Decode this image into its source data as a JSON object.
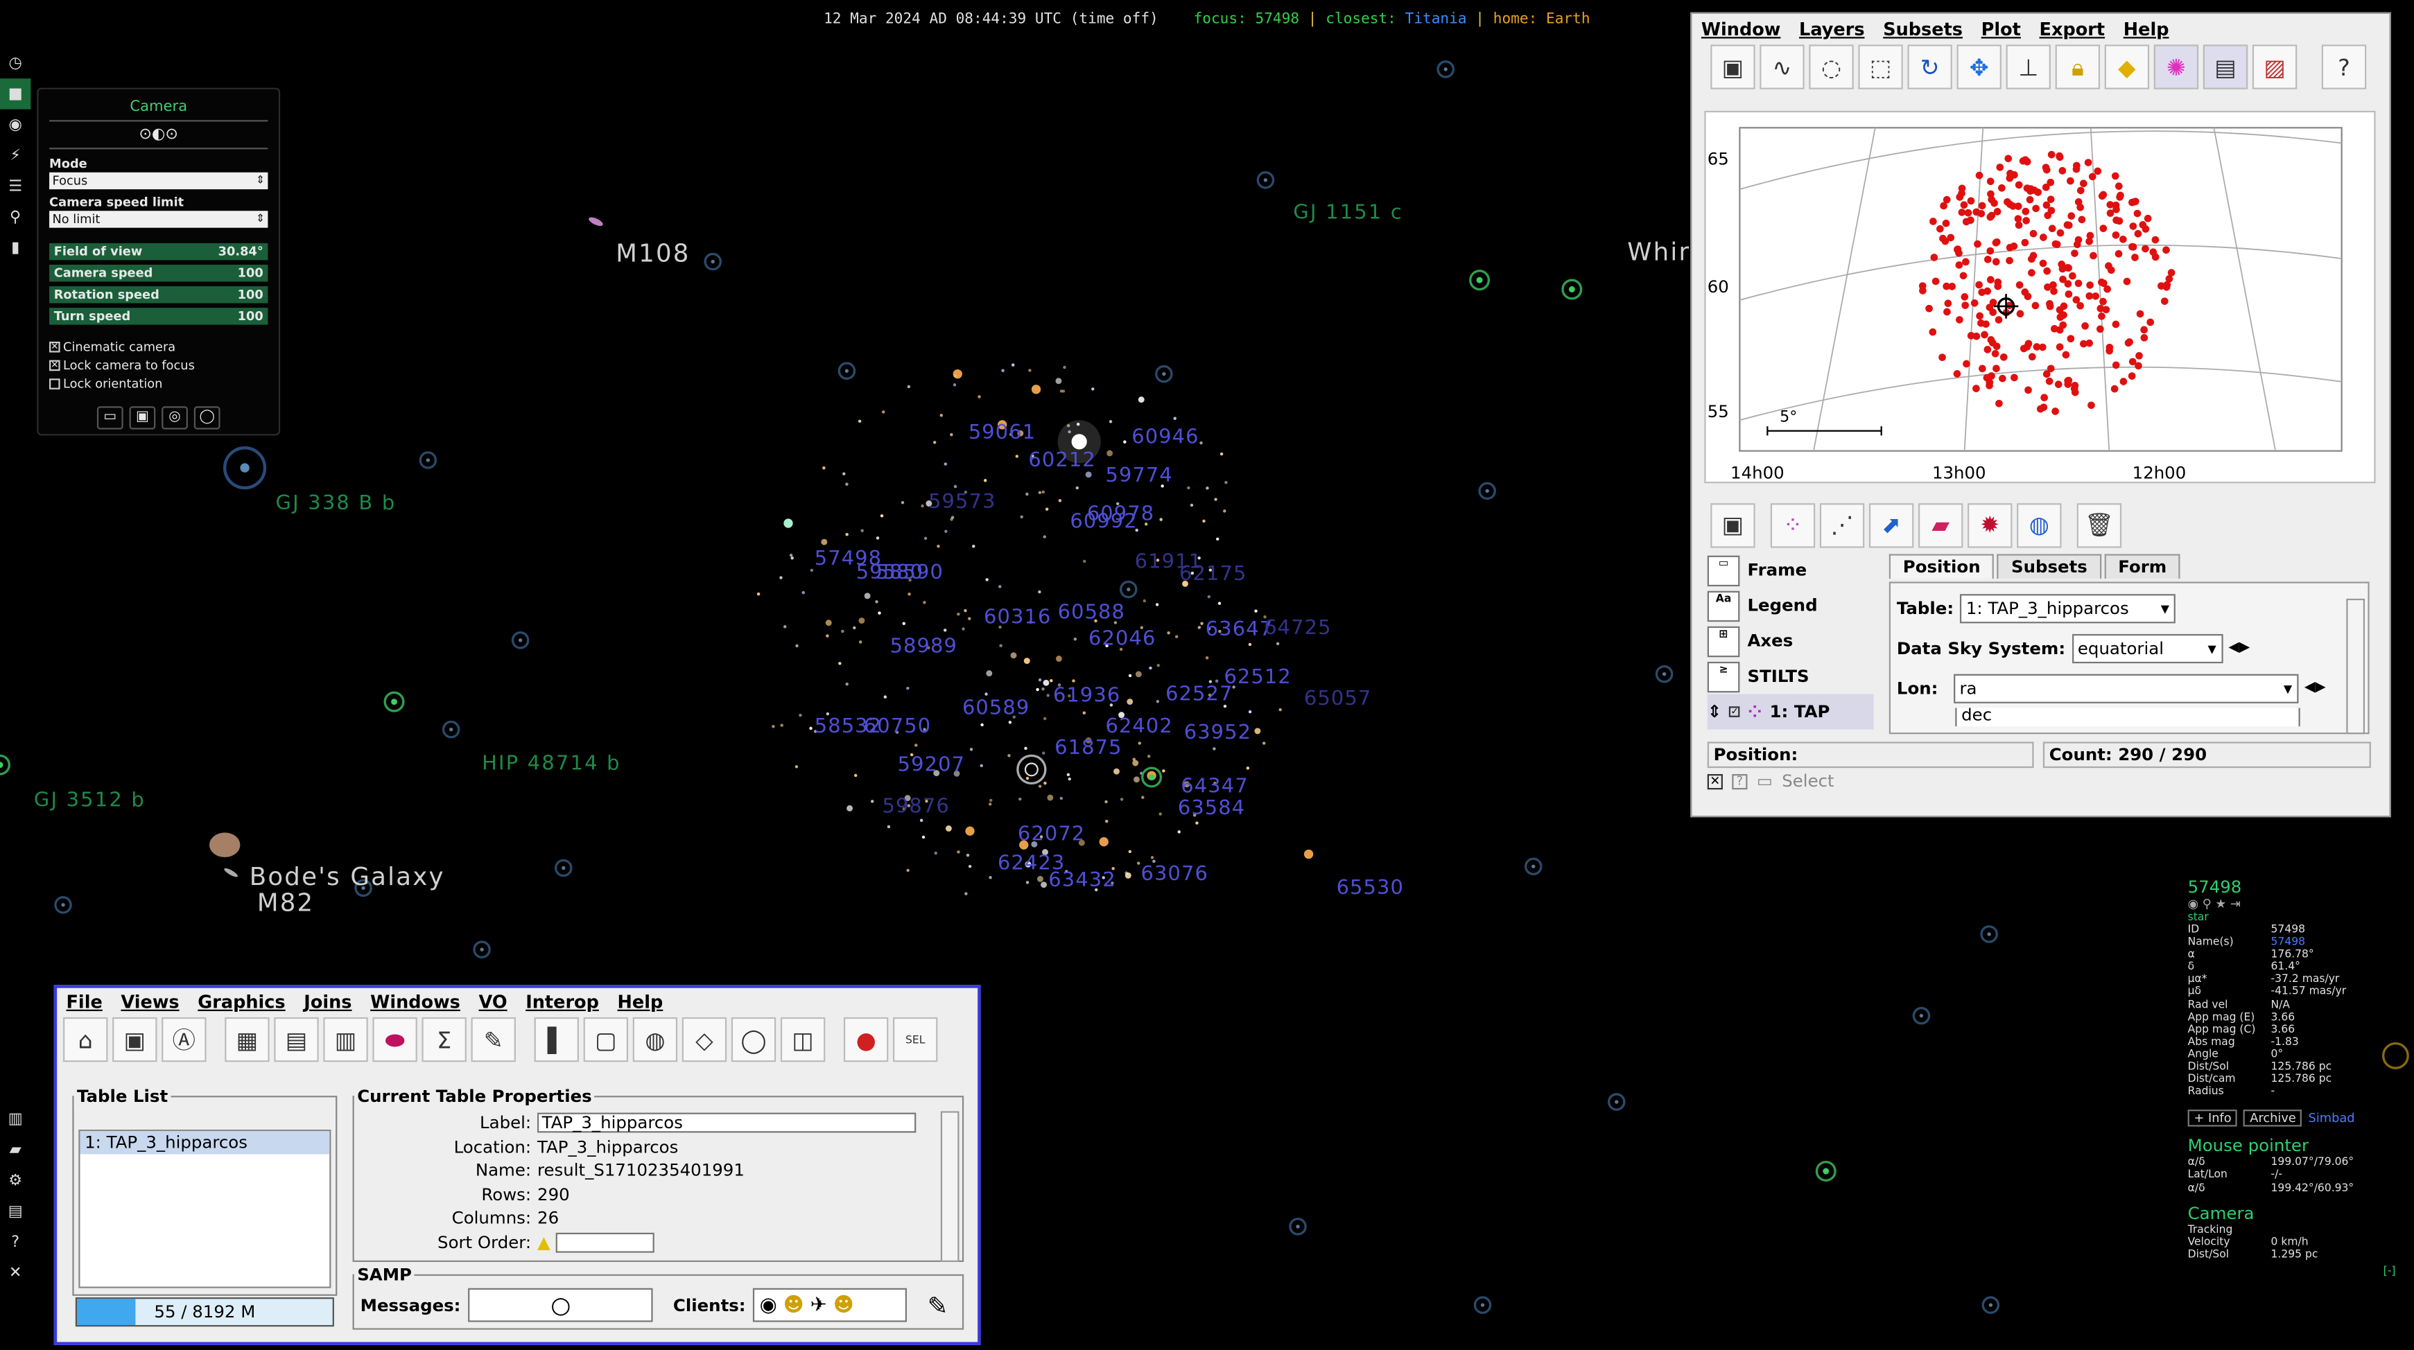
{
  "status_bar": {
    "datetime": "12 Mar 2024 AD 08:44:39 UTC (time off)",
    "focus_label": "focus:",
    "focus_value": "57498",
    "closest_label": "closest:",
    "closest_value": "Titania",
    "home_label": "home:",
    "home_value": "Earth",
    "separator": "|",
    "colors": {
      "focus": "#32d04a",
      "closest": "#3a8cff",
      "home": "#e8a020"
    }
  },
  "sky": {
    "deep_sky_labels": [
      "M108",
      "Bode's Galaxy",
      "M82",
      "Whir"
    ],
    "exoplanet_labels": [
      "GJ 1151 c",
      "GJ 338 B b",
      "HIP 48714 b",
      "GJ 3512 b"
    ],
    "star_ids": [
      "59061",
      "60212",
      "60946",
      "59774",
      "60978",
      "60992",
      "57498",
      "58590",
      "59580",
      "60316",
      "60588",
      "58989",
      "62046",
      "63647",
      "62512",
      "60589",
      "61936",
      "62527",
      "58532",
      "60750",
      "62402",
      "63952",
      "59207",
      "61875",
      "64347",
      "63584",
      "62072",
      "62423",
      "63432",
      "63076",
      "65530"
    ],
    "star_ids_dim": [
      "59573",
      "61911",
      "62175",
      "64725",
      "65057",
      "59876"
    ]
  },
  "camera_panel": {
    "title": "Camera",
    "mode_label": "Mode",
    "mode_value": "Focus",
    "speed_limit_label": "Camera speed limit",
    "speed_limit_value": "No limit",
    "fov_label": "Field of view",
    "fov_value": "30.84°",
    "camera_speed_label": "Camera speed",
    "camera_speed_value": "100",
    "rotation_speed_label": "Rotation speed",
    "rotation_speed_value": "100",
    "turn_speed_label": "Turn speed",
    "turn_speed_value": "100",
    "cinematic_label": "Cinematic camera",
    "cinematic_checked": true,
    "lock_focus_label": "Lock camera to focus",
    "lock_focus_checked": true,
    "lock_orientation_label": "Lock orientation",
    "lock_orientation_checked": false
  },
  "object_info": {
    "name": "57498",
    "type": "star",
    "rows": [
      {
        "k": "ID",
        "v": "57498"
      },
      {
        "k": "Name(s)",
        "v": "57498"
      },
      {
        "k": "α",
        "v": "176.78°"
      },
      {
        "k": "δ",
        "v": "61.4°"
      },
      {
        "k": "μα*",
        "v": "-37.2 mas/yr"
      },
      {
        "k": "μδ",
        "v": "-41.57 mas/yr"
      },
      {
        "k": "Rad vel",
        "v": "N/A"
      },
      {
        "k": "App mag (E)",
        "v": "3.66"
      },
      {
        "k": "App mag (C)",
        "v": "3.66"
      },
      {
        "k": "Abs mag",
        "v": "-1.83"
      },
      {
        "k": "Angle",
        "v": "0°"
      },
      {
        "k": "Dist/Sol",
        "v": "125.786 pc"
      },
      {
        "k": "Dist/cam",
        "v": "125.786 pc"
      },
      {
        "k": "Radius",
        "v": "-"
      }
    ],
    "more_info_label": "+ Info",
    "archive_label": "Archive",
    "simbad_label": "Simbad",
    "mouse_title": "Mouse pointer",
    "mouse_rows": [
      {
        "k": "α/δ",
        "v": "199.07°/79.06°"
      },
      {
        "k": "Lat/Lon",
        "v": "-/-"
      },
      {
        "k": "α/δ",
        "v": "199.42°/60.93°"
      }
    ],
    "camera_title": "Camera",
    "camera_rows": [
      {
        "k": "Tracking",
        "v": ""
      },
      {
        "k": "Velocity",
        "v": "0 km/h"
      },
      {
        "k": "Dist/Sol",
        "v": "1.295 pc"
      }
    ],
    "corner_mark": "[-]"
  },
  "topcat": {
    "menu": [
      "File",
      "Views",
      "Graphics",
      "Joins",
      "Windows",
      "VO",
      "Interop",
      "Help"
    ],
    "table_list_title": "Table List",
    "table_list_items": [
      "1: TAP_3_hipparcos"
    ],
    "memory_label": "55 / 8192 M",
    "memory_fraction": 0.23,
    "props_title": "Current Table Properties",
    "props": [
      {
        "k": "Label:",
        "v": "TAP_3_hipparcos",
        "input": true
      },
      {
        "k": "Location:",
        "v": "TAP_3_hipparcos",
        "input": false
      },
      {
        "k": "Name:",
        "v": "result_S1710235401991",
        "input": false
      },
      {
        "k": "Rows:",
        "v": "290",
        "input": false
      },
      {
        "k": "Columns:",
        "v": "26",
        "input": false
      },
      {
        "k": "Sort Order:",
        "v": "",
        "input": false
      }
    ],
    "samp_title": "SAMP",
    "messages_label": "Messages:",
    "clients_label": "Clients:"
  },
  "plot_window": {
    "menu": [
      "Window",
      "Layers",
      "Subsets",
      "Plot",
      "Export",
      "Help"
    ],
    "y_ticks": [
      "65",
      "60",
      "55"
    ],
    "x_ticks": [
      "14h00",
      "13h00",
      "12h00"
    ],
    "scale_label": "5°",
    "layers": [
      "Frame",
      "Legend",
      "Axes",
      "STILTS",
      "1: TAP"
    ],
    "tabs": [
      "Position",
      "Subsets",
      "Form"
    ],
    "table_label": "Table:",
    "table_value": "1: TAP_3_hipparcos",
    "sky_system_label": "Data Sky System:",
    "sky_system_value": "equatorial",
    "lon_label": "Lon:",
    "lon_value": "ra",
    "lat_value": "dec",
    "position_label": "Position:",
    "count_label": "Count: 290 / 290",
    "select_label": "Select",
    "point_color": "#e01010"
  }
}
